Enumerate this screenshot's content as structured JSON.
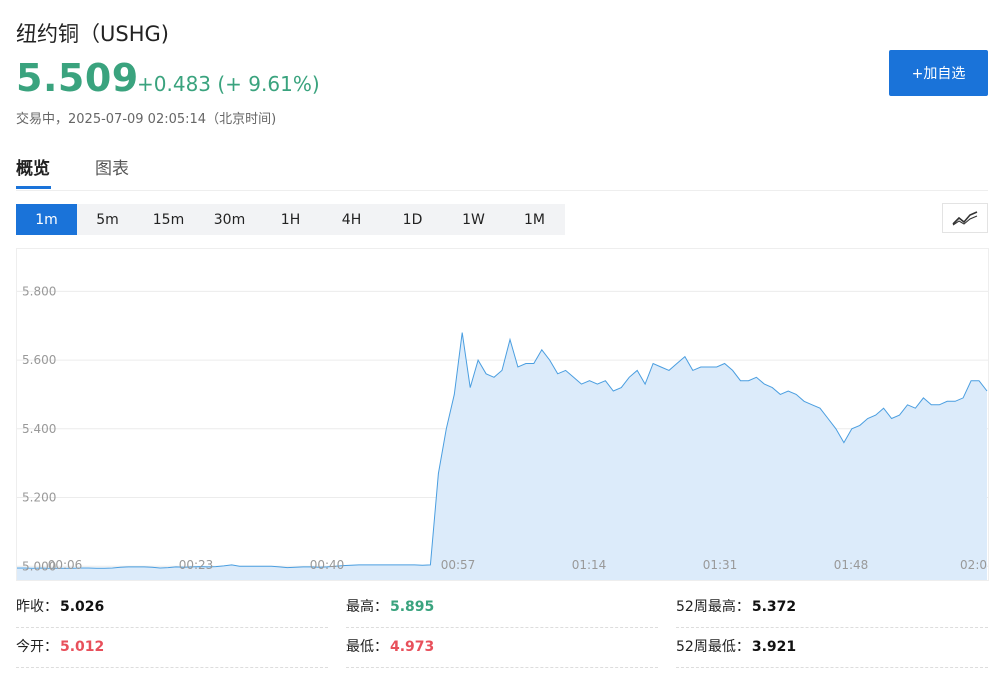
{
  "header": {
    "title": "纽约铜（USHG)",
    "price": "5.509",
    "change": "+0.483 (+ 9.61%)",
    "status": "交易中，2025-07-09 02:05:14（北京时间)",
    "add_button": "+加自选"
  },
  "tabs": [
    {
      "label": "概览",
      "active": true
    },
    {
      "label": "图表",
      "active": false
    }
  ],
  "ranges": [
    "1m",
    "5m",
    "15m",
    "30m",
    "1H",
    "4H",
    "1D",
    "1W",
    "1M"
  ],
  "active_range": "1m",
  "chart_type_icon": "line-chart-icon",
  "colors": {
    "accent": "#1a73d9",
    "up": "#3aa37e",
    "down": "#e8505b",
    "line": "#4a9ee0",
    "fill": "#dcebfa"
  },
  "chart_data": {
    "type": "area",
    "xlabel": "",
    "ylabel": "",
    "x_ticks": [
      "00:06",
      "00:23",
      "00:40",
      "00:57",
      "01:14",
      "01:31",
      "01:48",
      "02:0"
    ],
    "y_ticks": [
      "5.800",
      "5.600",
      "5.400",
      "5.200",
      "5.000"
    ],
    "ylim": [
      4.96,
      5.9
    ],
    "grid": true,
    "series": [
      {
        "values": [
          4.995,
          4.995,
          4.994,
          4.995,
          4.994,
          4.994,
          4.994,
          4.994,
          4.995,
          4.995,
          4.994,
          4.994,
          4.995,
          4.997,
          4.998,
          4.998,
          4.998,
          4.997,
          4.995,
          4.996,
          4.998,
          4.997,
          4.998,
          4.999,
          4.998,
          4.999,
          5.001,
          5.004,
          5.0,
          5.0,
          5.0,
          5.0,
          5.0,
          4.998,
          4.996,
          4.997,
          4.998,
          4.998,
          4.997,
          4.998,
          5.0,
          5.002,
          5.003,
          5.004,
          5.004,
          5.004,
          5.004,
          5.004,
          5.004,
          5.004,
          5.004,
          5.003,
          5.004,
          5.27,
          5.4,
          5.5,
          5.68,
          5.52,
          5.6,
          5.56,
          5.55,
          5.57,
          5.66,
          5.58,
          5.59,
          5.59,
          5.63,
          5.6,
          5.56,
          5.57,
          5.55,
          5.53,
          5.54,
          5.53,
          5.54,
          5.51,
          5.52,
          5.55,
          5.57,
          5.53,
          5.59,
          5.58,
          5.57,
          5.59,
          5.61,
          5.57,
          5.58,
          5.58,
          5.58,
          5.59,
          5.57,
          5.54,
          5.54,
          5.55,
          5.53,
          5.52,
          5.5,
          5.51,
          5.5,
          5.48,
          5.47,
          5.46,
          5.43,
          5.4,
          5.36,
          5.4,
          5.41,
          5.43,
          5.44,
          5.46,
          5.43,
          5.44,
          5.47,
          5.46,
          5.49,
          5.47,
          5.47,
          5.48,
          5.48,
          5.49,
          5.54,
          5.54,
          5.51
        ]
      }
    ]
  },
  "stats": [
    [
      {
        "label": "昨收：",
        "value": "5.026",
        "tone": "dark"
      },
      {
        "label": "最高：",
        "value": "5.895",
        "tone": "green"
      },
      {
        "label": "52周最高：",
        "value": "5.372",
        "tone": "dark"
      }
    ],
    [
      {
        "label": "今开：",
        "value": "5.012",
        "tone": "red"
      },
      {
        "label": "最低：",
        "value": "4.973",
        "tone": "red"
      },
      {
        "label": "52周最低：",
        "value": "3.921",
        "tone": "dark"
      }
    ]
  ]
}
